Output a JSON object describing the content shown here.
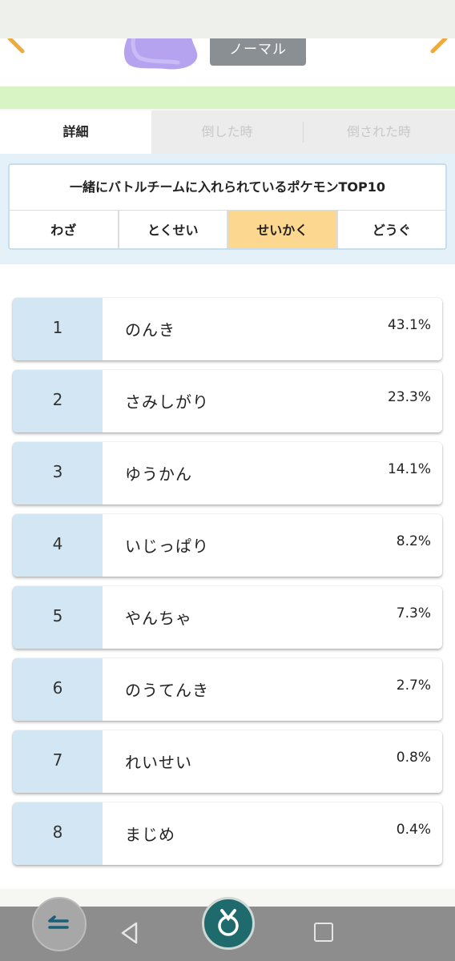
{
  "header": {
    "type_label": "ノーマル"
  },
  "tabs": [
    {
      "label": "詳細",
      "active": true
    },
    {
      "label": "倒した時",
      "active": false
    },
    {
      "label": "倒された時",
      "active": false
    }
  ],
  "panel": {
    "title": "一緒にバトルチームに入れられているポケモンTOP10",
    "subtabs": [
      {
        "label": "わざ",
        "active": false
      },
      {
        "label": "とくせい",
        "active": false
      },
      {
        "label": "せいかく",
        "active": true
      },
      {
        "label": "どうぐ",
        "active": false
      }
    ]
  },
  "ranking": [
    {
      "rank": "1",
      "name": "のんき",
      "percent": "43.1%"
    },
    {
      "rank": "2",
      "name": "さみしがり",
      "percent": "23.3%"
    },
    {
      "rank": "3",
      "name": "ゆうかん",
      "percent": "14.1%"
    },
    {
      "rank": "4",
      "name": "いじっぱり",
      "percent": "8.2%"
    },
    {
      "rank": "5",
      "name": "やんちゃ",
      "percent": "7.3%"
    },
    {
      "rank": "6",
      "name": "のうてんき",
      "percent": "2.7%"
    },
    {
      "rank": "7",
      "name": "れいせい",
      "percent": "0.8%"
    },
    {
      "rank": "8",
      "name": "まじめ",
      "percent": "0.4%"
    }
  ],
  "colors": {
    "accent_active_subtab": "#fcd78f",
    "rank_cell": "#d3e6f3",
    "green_band": "#d8f4c4",
    "type_badge": "#8a8f93"
  },
  "navbar": {
    "icons": [
      "back-gesture-icon",
      "triangle-back-icon",
      "home-app-icon",
      "recents-square-icon"
    ]
  }
}
